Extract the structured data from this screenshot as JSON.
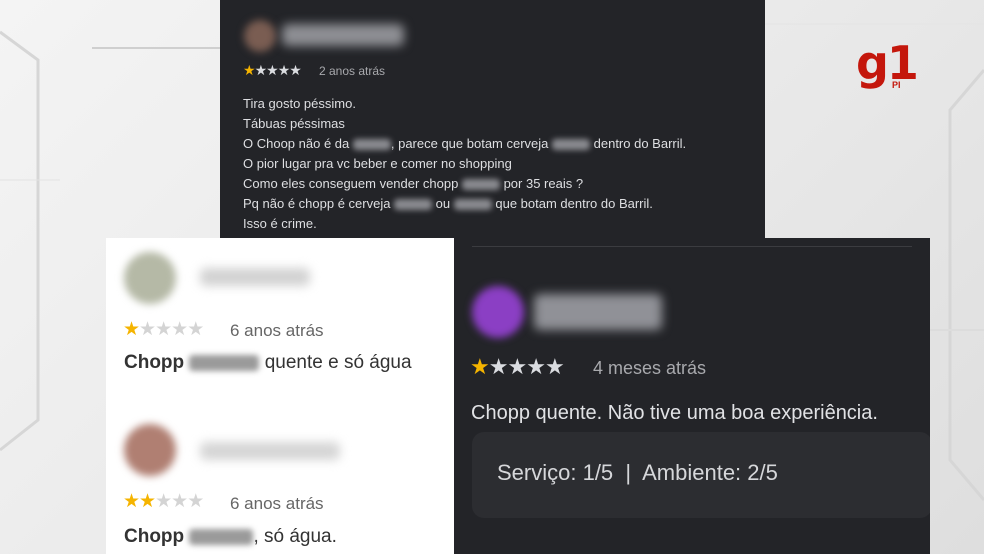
{
  "brand": {
    "logo": "g1",
    "region": "PI"
  },
  "review_top": {
    "stars": 1,
    "max_stars": 5,
    "time": "2 anos atrás",
    "lines": [
      [
        "Tira gosto péssimo."
      ],
      [
        "Tábuas péssimas"
      ],
      [
        "O Choop não é da ",
        "",
        ", parece que botam cerveja ",
        "",
        " dentro do Barril."
      ],
      [
        "O pior lugar pra vc beber e comer no shopping"
      ],
      [
        "Como eles conseguem vender chopp ",
        "",
        " por 35 reais ?"
      ],
      [
        "Pq não é chopp é cerveja ",
        "",
        " ou ",
        "",
        " que botam dentro do Barril."
      ],
      [
        "Isso é crime."
      ]
    ]
  },
  "review_left_1": {
    "stars": 1,
    "max_stars": 5,
    "time": "6 anos atrás",
    "text_start": "Chopp ",
    "text_end": " quente e só água"
  },
  "review_left_2": {
    "stars": 2,
    "max_stars": 5,
    "time": "6 anos atrás",
    "text_start": "Chopp ",
    "text_end": ", só água."
  },
  "review_right": {
    "stars": 1,
    "max_stars": 5,
    "time": "4 meses atrás",
    "text": "Chopp quente. Não tive uma boa experiência.",
    "ratings": "Serviço: 1/5  |  Ambiente: 2/5"
  },
  "colors": {
    "star_on": "#f5b400",
    "dark_bg": "#232428",
    "brand_red": "#c4170c"
  }
}
